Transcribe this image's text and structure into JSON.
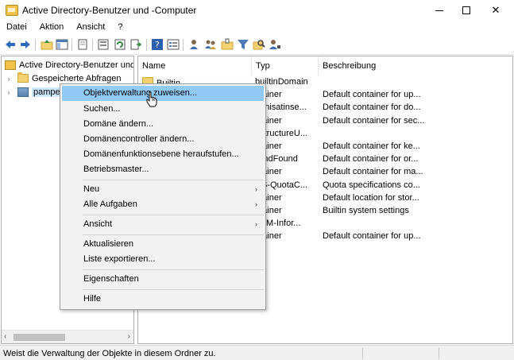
{
  "window": {
    "title": "Active Directory-Benutzer und -Computer",
    "minimize_icon": "minimize-icon",
    "maximize_icon": "maximize-icon",
    "close_icon": "close-icon",
    "close_glyph": "✕"
  },
  "menubar": {
    "items": [
      {
        "label": "Datei"
      },
      {
        "label": "Aktion"
      },
      {
        "label": "Ansicht"
      },
      {
        "label": "?"
      }
    ]
  },
  "toolbar": {
    "icons": [
      "back-arrow-icon",
      "forward-arrow-icon",
      "up-folder-icon",
      "show-hide-console-tree-icon",
      "copy-icon",
      "properties-icon",
      "refresh-icon",
      "export-list-icon",
      "help-icon",
      "details-view-icon",
      "new-user-icon",
      "new-group-icon",
      "new-ou-icon",
      "filter-icon",
      "find-icon",
      "add-to-group-icon"
    ]
  },
  "tree": {
    "items": [
      {
        "label": "Active Directory-Benutzer und -",
        "icon": "ad-root-icon"
      },
      {
        "label": "Gespeicherte Abfragen",
        "icon": "folder-icon"
      },
      {
        "label": "pamper",
        "icon": "domain-icon"
      }
    ]
  },
  "list": {
    "columns": [
      "Name",
      "Typ",
      "Beschreibung"
    ],
    "rows": [
      {
        "name": "Builtin",
        "type": "builtinDomain",
        "desc": ""
      },
      {
        "name": "",
        "type": "ntainer",
        "desc": "Default container for up..."
      },
      {
        "name": "",
        "type": "ganisatinse...",
        "desc": "Default container for do..."
      },
      {
        "name": "",
        "type": "ntainer",
        "desc": "Default container for sec..."
      },
      {
        "name": "",
        "type": "astructureU...",
        "desc": ""
      },
      {
        "name": "",
        "type": "ntainer",
        "desc": "Default container for ke..."
      },
      {
        "name": "",
        "type": "tAndFound",
        "desc": "Default container for or..."
      },
      {
        "name": "",
        "type": "ntainer",
        "desc": "Default container for ma..."
      },
      {
        "name": "",
        "type": "DS-QuotaC...",
        "desc": "Quota specifications co..."
      },
      {
        "name": "",
        "type": "ntainer",
        "desc": "Default location for stor..."
      },
      {
        "name": "",
        "type": "ntainer",
        "desc": "Builtin system settings"
      },
      {
        "name": "",
        "type": "TPM-Infor...",
        "desc": ""
      },
      {
        "name": "",
        "type": "ntainer",
        "desc": "Default container for up..."
      }
    ]
  },
  "context_menu": {
    "items": [
      {
        "label": "Objektverwaltung zuweisen...",
        "highlighted": true
      },
      {
        "label": "Suchen..."
      },
      {
        "label": "Domäne ändern..."
      },
      {
        "label": "Domänencontroller ändern..."
      },
      {
        "label": "Domänenfunktionsebene heraufstufen..."
      },
      {
        "label": "Betriebsmaster..."
      },
      {
        "label": "Neu",
        "submenu": true
      },
      {
        "label": "Alle Aufgaben",
        "submenu": true
      },
      {
        "label": "Ansicht",
        "submenu": true
      },
      {
        "label": "Aktualisieren"
      },
      {
        "label": "Liste exportieren..."
      },
      {
        "label": "Eigenschaften"
      },
      {
        "label": "Hilfe"
      }
    ],
    "submenu_glyph": "›"
  },
  "statusbar": {
    "text": "Weist die Verwaltung der Objekte in diesem Ordner zu."
  },
  "colors": {
    "highlight": "#91c9f7",
    "menu_bg": "#f2f2f2",
    "folder": "#f4d272"
  }
}
